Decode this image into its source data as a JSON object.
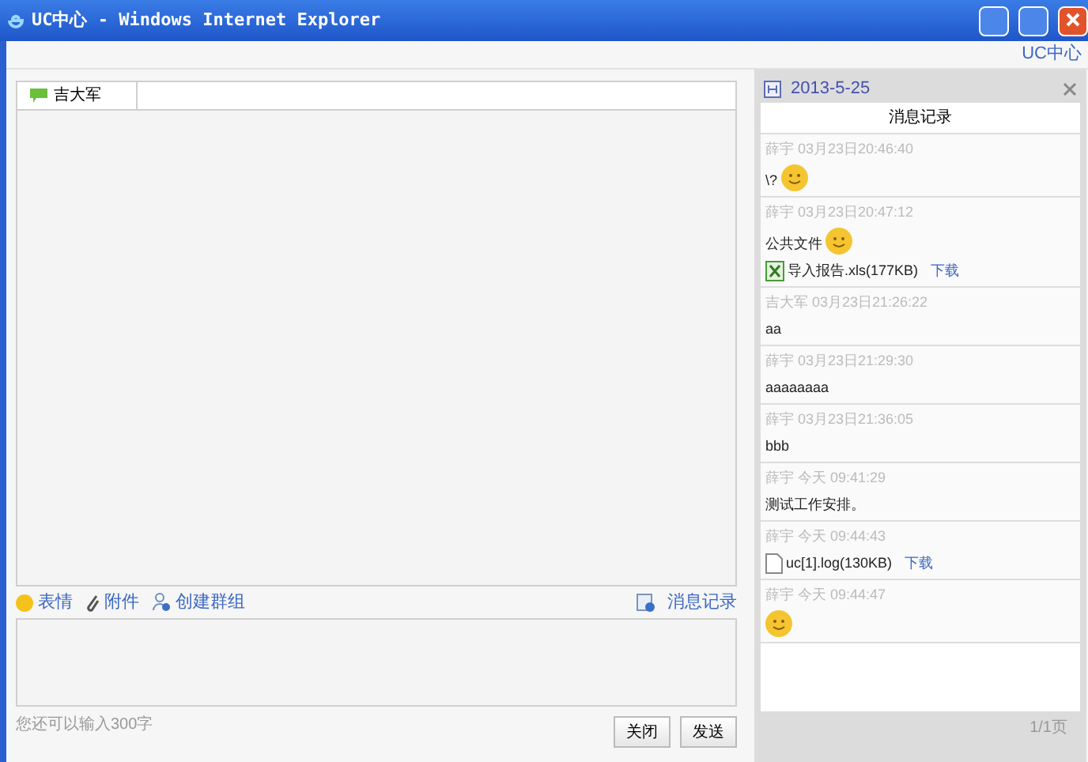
{
  "window": {
    "title": "UC中心 - Windows Internet Explorer"
  },
  "toolbar": {
    "link": "UC中心"
  },
  "chat": {
    "tabs": [
      {
        "label": "吉大军",
        "selected": true
      }
    ],
    "actions": [
      {
        "kind": "emoji",
        "label": "表情"
      },
      {
        "kind": "attach",
        "label": "附件"
      },
      {
        "kind": "group",
        "label": "创建群组"
      }
    ],
    "history_link": "消息记录",
    "hint": "您还可以输入300字",
    "buttons": [
      "关闭",
      "发送"
    ]
  },
  "history": {
    "date": "2013-5-25",
    "title": "消息记录",
    "page": "1/1页",
    "messages": [
      {
        "header": "薛宇 03月23日20:46:40",
        "lines": [
          [
            {
              "kind": "text",
              "text": "\\?"
            },
            {
              "kind": "emoji"
            }
          ]
        ]
      },
      {
        "header": "薛宇 03月23日20:47:12",
        "lines": [
          [
            {
              "kind": "text",
              "text": "公共文件"
            },
            {
              "kind": "emoji"
            }
          ],
          [
            {
              "kind": "sheet_file",
              "text": "导入报告.xls(177KB)",
              "link": "下载"
            }
          ]
        ]
      },
      {
        "header": "吉大军 03月23日21:26:22",
        "lines": [
          [
            {
              "kind": "text",
              "text": "aa"
            }
          ]
        ]
      },
      {
        "header": "薛宇 03月23日21:29:30",
        "lines": [
          [
            {
              "kind": "text",
              "text": "aaaaaaaa"
            }
          ]
        ]
      },
      {
        "header": "薛宇 03月23日21:36:05",
        "lines": [
          [
            {
              "kind": "text",
              "text": "bbb"
            }
          ]
        ]
      },
      {
        "header": "薛宇 今天 09:41:29",
        "lines": [
          [
            {
              "kind": "text",
              "text": "测试工作安排。"
            }
          ]
        ]
      },
      {
        "header": "薛宇 今天 09:44:43",
        "lines": [
          [
            {
              "kind": "doc_file",
              "text": "uc[1].log(130KB)",
              "link": "下载"
            }
          ]
        ]
      },
      {
        "header": "薛宇 今天 09:44:47",
        "lines": [
          [
            {
              "kind": "emoji"
            }
          ]
        ]
      }
    ]
  }
}
